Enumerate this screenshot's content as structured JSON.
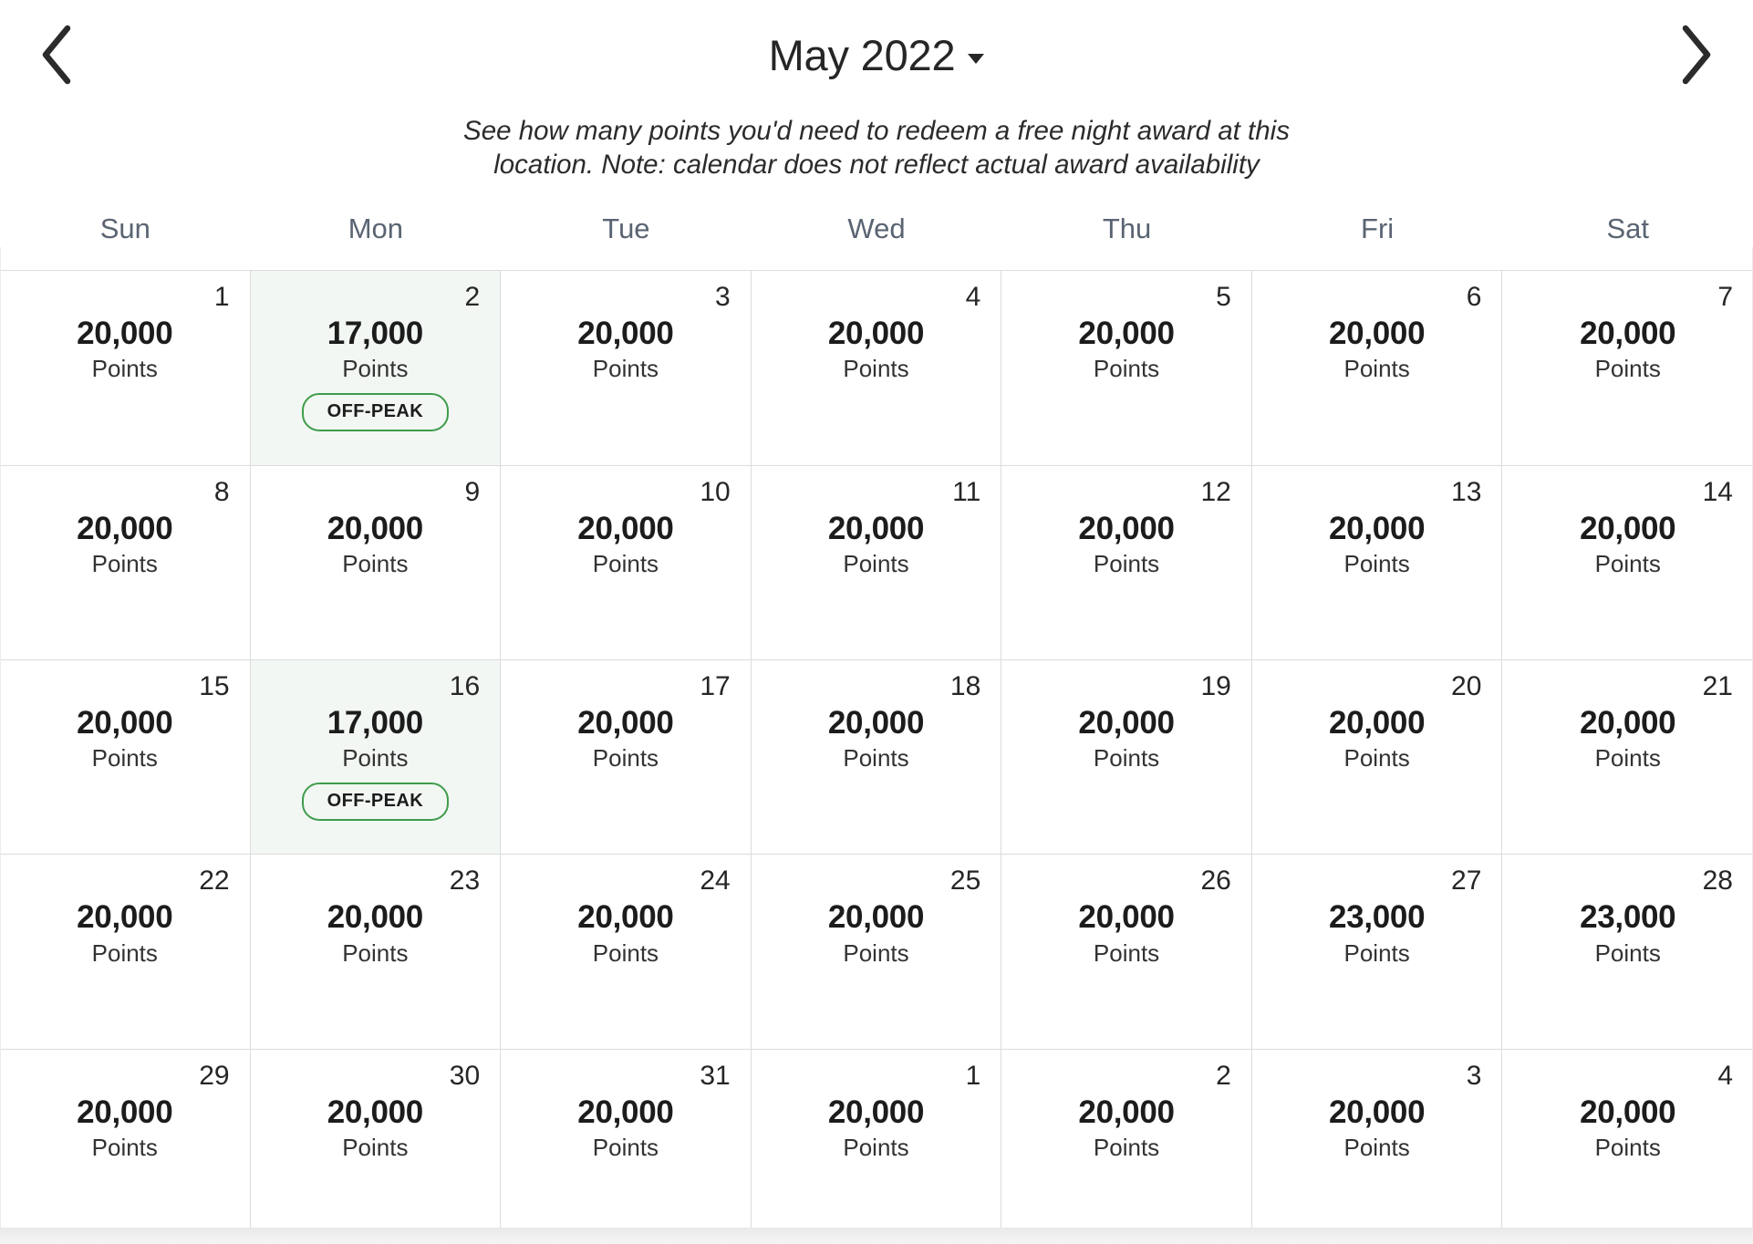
{
  "header": {
    "month_label": "May 2022",
    "prev_icon": "chevron-left-icon",
    "next_icon": "chevron-right-icon",
    "dropdown_icon": "caret-down-icon"
  },
  "description": {
    "line1": "See how many points you'd need to redeem a free night award at this",
    "line2": "location. Note: calendar does not reflect actual award availability"
  },
  "weekdays": [
    {
      "label": "Sun"
    },
    {
      "label": "Mon"
    },
    {
      "label": "Tue"
    },
    {
      "label": "Wed"
    },
    {
      "label": "Thu"
    },
    {
      "label": "Fri"
    },
    {
      "label": "Sat"
    }
  ],
  "badge_label": "OFF-PEAK",
  "points_label": "Points",
  "colors": {
    "offpeak_cell_bg": "#f2f7f3",
    "offpeak_border": "#3f9c4b",
    "weekday_text": "#5a6472",
    "grid_line": "#dcdcdc",
    "title_text": "#262626"
  },
  "days": [
    {
      "number": "1",
      "points": "20,000",
      "label": "Points",
      "offpeak": false
    },
    {
      "number": "2",
      "points": "17,000",
      "label": "Points",
      "offpeak": true,
      "badge": "OFF-PEAK"
    },
    {
      "number": "3",
      "points": "20,000",
      "label": "Points",
      "offpeak": false
    },
    {
      "number": "4",
      "points": "20,000",
      "label": "Points",
      "offpeak": false
    },
    {
      "number": "5",
      "points": "20,000",
      "label": "Points",
      "offpeak": false
    },
    {
      "number": "6",
      "points": "20,000",
      "label": "Points",
      "offpeak": false
    },
    {
      "number": "7",
      "points": "20,000",
      "label": "Points",
      "offpeak": false
    },
    {
      "number": "8",
      "points": "20,000",
      "label": "Points",
      "offpeak": false
    },
    {
      "number": "9",
      "points": "20,000",
      "label": "Points",
      "offpeak": false
    },
    {
      "number": "10",
      "points": "20,000",
      "label": "Points",
      "offpeak": false
    },
    {
      "number": "11",
      "points": "20,000",
      "label": "Points",
      "offpeak": false
    },
    {
      "number": "12",
      "points": "20,000",
      "label": "Points",
      "offpeak": false
    },
    {
      "number": "13",
      "points": "20,000",
      "label": "Points",
      "offpeak": false
    },
    {
      "number": "14",
      "points": "20,000",
      "label": "Points",
      "offpeak": false
    },
    {
      "number": "15",
      "points": "20,000",
      "label": "Points",
      "offpeak": false
    },
    {
      "number": "16",
      "points": "17,000",
      "label": "Points",
      "offpeak": true,
      "badge": "OFF-PEAK"
    },
    {
      "number": "17",
      "points": "20,000",
      "label": "Points",
      "offpeak": false
    },
    {
      "number": "18",
      "points": "20,000",
      "label": "Points",
      "offpeak": false
    },
    {
      "number": "19",
      "points": "20,000",
      "label": "Points",
      "offpeak": false
    },
    {
      "number": "20",
      "points": "20,000",
      "label": "Points",
      "offpeak": false
    },
    {
      "number": "21",
      "points": "20,000",
      "label": "Points",
      "offpeak": false
    },
    {
      "number": "22",
      "points": "20,000",
      "label": "Points",
      "offpeak": false
    },
    {
      "number": "23",
      "points": "20,000",
      "label": "Points",
      "offpeak": false
    },
    {
      "number": "24",
      "points": "20,000",
      "label": "Points",
      "offpeak": false
    },
    {
      "number": "25",
      "points": "20,000",
      "label": "Points",
      "offpeak": false
    },
    {
      "number": "26",
      "points": "20,000",
      "label": "Points",
      "offpeak": false
    },
    {
      "number": "27",
      "points": "23,000",
      "label": "Points",
      "offpeak": false
    },
    {
      "number": "28",
      "points": "23,000",
      "label": "Points",
      "offpeak": false
    },
    {
      "number": "29",
      "points": "20,000",
      "label": "Points",
      "offpeak": false
    },
    {
      "number": "30",
      "points": "20,000",
      "label": "Points",
      "offpeak": false
    },
    {
      "number": "31",
      "points": "20,000",
      "label": "Points",
      "offpeak": false
    },
    {
      "number": "1",
      "points": "20,000",
      "label": "Points",
      "offpeak": false
    },
    {
      "number": "2",
      "points": "20,000",
      "label": "Points",
      "offpeak": false
    },
    {
      "number": "3",
      "points": "20,000",
      "label": "Points",
      "offpeak": false
    },
    {
      "number": "4",
      "points": "20,000",
      "label": "Points",
      "offpeak": false
    }
  ]
}
